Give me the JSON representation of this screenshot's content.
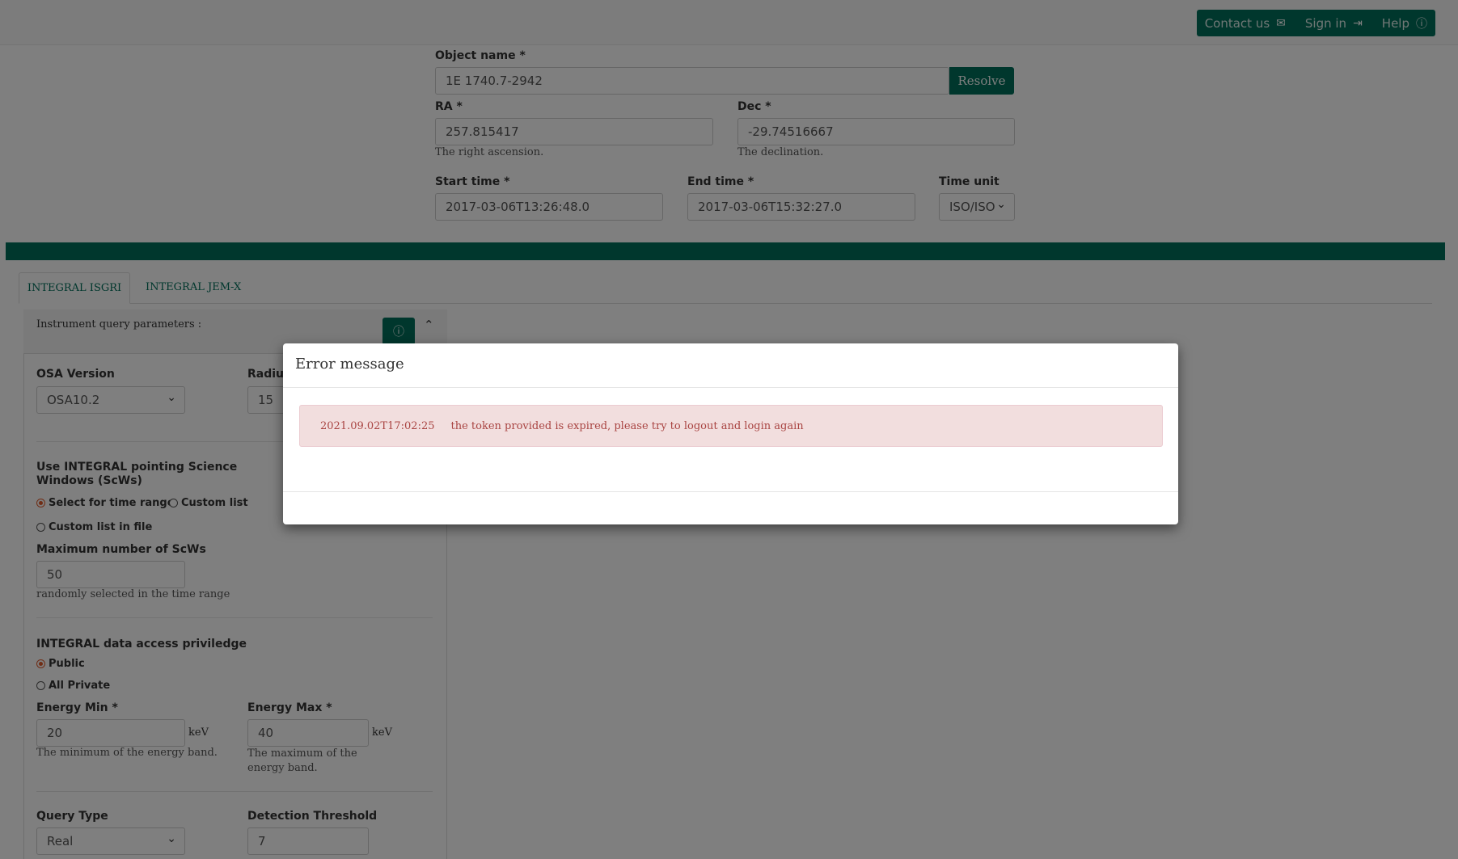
{
  "nav": {
    "contact": "Contact us",
    "signin": "Sign in",
    "help": "Help"
  },
  "object": {
    "name_label": "Object name *",
    "name_value": "1E 1740.7-2942",
    "resolve": "Resolve",
    "ra_label": "RA *",
    "ra_value": "257.815417",
    "ra_help": "The right ascension.",
    "dec_label": "Dec *",
    "dec_value": "-29.74516667",
    "dec_help": "The declination.",
    "start_label": "Start time *",
    "start_value": "2017-03-06T13:26:48.0",
    "end_label": "End time *",
    "end_value": "2017-03-06T15:32:27.0",
    "unit_label": "Time unit",
    "unit_value": "ISO/ISO"
  },
  "tabs": [
    {
      "label": "INTEGRAL ISGRI"
    },
    {
      "label": "INTEGRAL JEM-X"
    }
  ],
  "panel": {
    "heading": "Instrument query parameters :",
    "osa_label": "OSA Version",
    "osa_value": "OSA10.2",
    "radius_label": "Radius",
    "radius_value": "15",
    "scw_label": "Use INTEGRAL pointing Science Windows (ScWs)",
    "scw_opt1": "Select for time range",
    "scw_opt2": "Custom list",
    "scw_opt3": "Custom list in file",
    "max_label": "Maximum number of ScWs",
    "max_value": "50",
    "max_help": "randomly selected in the time range",
    "access_label": "INTEGRAL data access priviledge",
    "access_opt1": "Public",
    "access_opt2": "All Private",
    "emin_label": "Energy Min *",
    "emin_value": "20",
    "emin_unit": "keV",
    "emin_help": "The minimum of the energy band.",
    "emax_label": "Energy Max *",
    "emax_value": "40",
    "emax_unit": "keV",
    "emax_help": "The maximum of the energy band.",
    "qtype_label": "Query Type",
    "qtype_value": "Real",
    "det_label": "Detection Threshold",
    "det_value": "7"
  },
  "modal": {
    "title": "Error message",
    "timestamp": "2021.09.02T17:02:25",
    "message": "the token provided is expired, please try to logout and login again"
  },
  "colors": {
    "brand": "#006e5a",
    "alert_bg": "#f2dede",
    "alert_text": "#a94442",
    "radio_on": "#e05a2b"
  },
  "icons": {
    "contact": "envelope-icon",
    "signin": "sign-in-icon",
    "help": "info-circle-icon",
    "panel_info": "info-circle-icon",
    "collapse": "chevron-up-icon"
  }
}
